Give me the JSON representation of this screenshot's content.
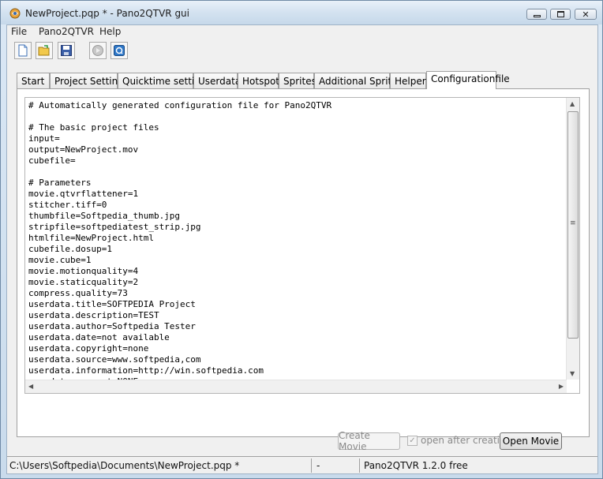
{
  "window": {
    "title": "NewProject.pqp * - Pano2QTVR gui",
    "minimize_icon": "minimize-icon",
    "maximize_icon": "maximize-icon",
    "close_icon": "close-icon",
    "close_glyph": "✕"
  },
  "menu": {
    "items": [
      {
        "label": "File"
      },
      {
        "label": "Pano2QTVR"
      },
      {
        "label": "Help"
      }
    ]
  },
  "toolbar": {
    "buttons": [
      {
        "icon": "new-document-icon"
      },
      {
        "icon": "open-folder-icon"
      },
      {
        "icon": "save-icon"
      },
      {
        "icon": "disabled-circle-icon"
      },
      {
        "icon": "preview-icon"
      }
    ]
  },
  "tabs": [
    {
      "label": "Start"
    },
    {
      "label": "Project Settings"
    },
    {
      "label": "Quicktime settings"
    },
    {
      "label": "Userdata"
    },
    {
      "label": "Hotspots"
    },
    {
      "label": "Sprites"
    },
    {
      "label": "Additional Sprites"
    },
    {
      "label": "Helpers"
    },
    {
      "label": "Configurationfile"
    }
  ],
  "active_tab": "Configurationfile",
  "config_lines": [
    "# Automatically generated configuration file for Pano2QTVR",
    "",
    "# The basic project files",
    "input=",
    "output=NewProject.mov",
    "cubefile=",
    "",
    "# Parameters",
    "movie.qtvrflattener=1",
    "stitcher.tiff=0",
    "thumbfile=Softpedia_thumb.jpg",
    "stripfile=softpediatest_strip.jpg",
    "htmlfile=NewProject.html",
    "cubefile.dosup=1",
    "movie.cube=1",
    "movie.motionquality=4",
    "movie.staticquality=2",
    "compress.quality=73",
    "userdata.title=SOFTPEDIA Project",
    "userdata.description=TEST",
    "userdata.author=Softpedia Tester",
    "userdata.date=not available",
    "userdata.copyright=none",
    "userdata.source=www.softpedia,com",
    "userdata.information=http://win.softpedia.com",
    "userdata.comment=NONE"
  ],
  "scroll": {
    "up": "▲",
    "down": "▼",
    "left": "◀",
    "right": "▶",
    "grip": "≡"
  },
  "actions": {
    "create_movie": "Create Movie",
    "open_after_creation": "open after creation",
    "open_after_creation_checked": true,
    "open_movie": "Open Movie"
  },
  "status": {
    "path": "C:\\Users\\Softpedia\\Documents\\NewProject.pqp *",
    "middle": "-",
    "version": "Pano2QTVR 1.2.0 free"
  }
}
